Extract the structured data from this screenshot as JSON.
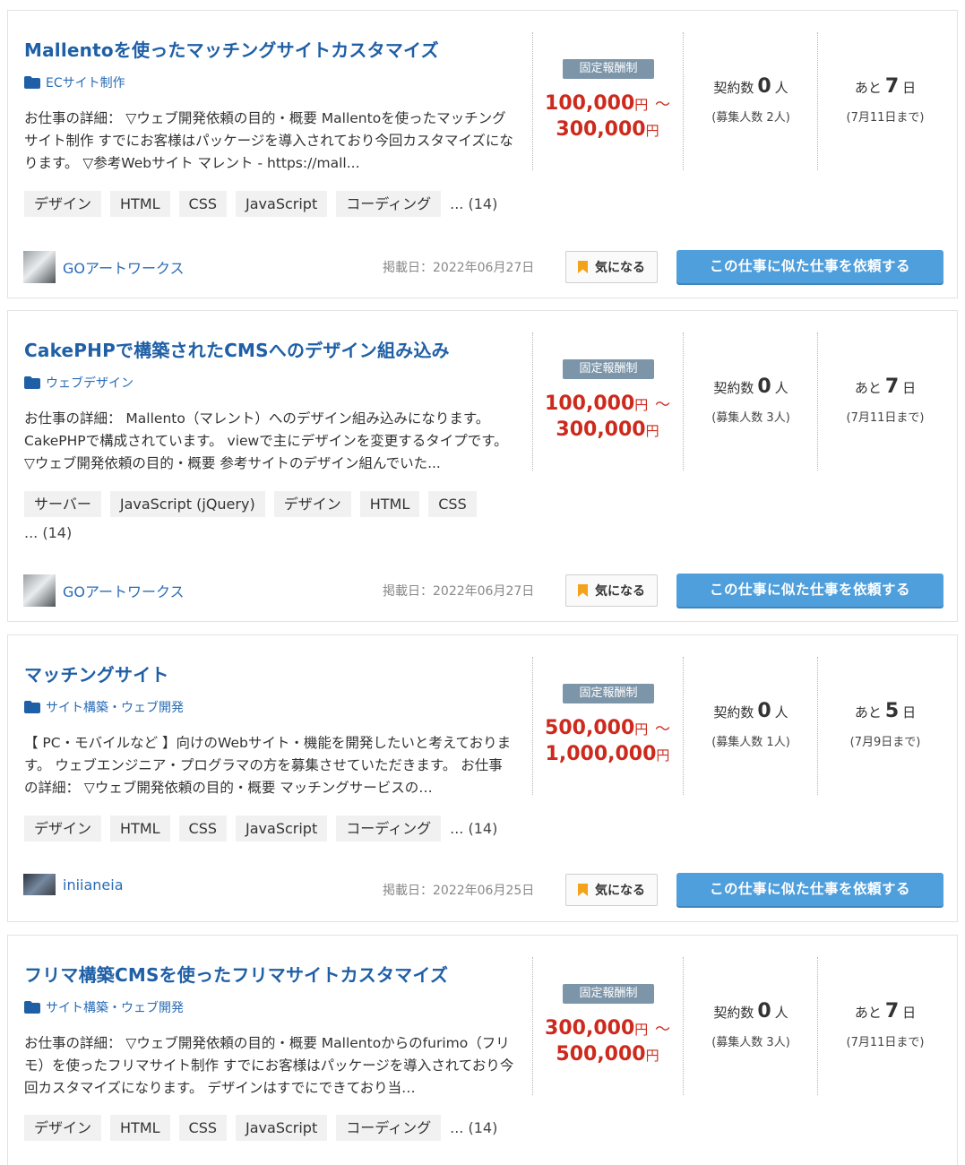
{
  "jobs": [
    {
      "title": "Mallentoを使ったマッチングサイトカスタマイズ",
      "category": "ECサイト制作",
      "description": "お仕事の詳細： ▽ウェブ開発依頼の目的・概要 Mallentoを使ったマッチングサイト制作 すでにお客様はパッケージを導入されており今回カスタマイズになります。 ▽参考Webサイト マレント - https://mall...",
      "tags": [
        "デザイン",
        "HTML",
        "CSS",
        "JavaScript",
        "コーディング"
      ],
      "tag_more": "...  (14)",
      "badge": "固定報酬制",
      "price_min": "100,000",
      "price_max": "300,000",
      "yen": "円",
      "tilde": "〜",
      "contract_prefix": "契約数",
      "contract_count": "0",
      "contract_unit": "人",
      "recruit": "(募集人数 2人)",
      "deadline_prefix": "あと",
      "deadline_days": "7",
      "deadline_unit": "日",
      "deadline_date": "(7月11日まで)",
      "client": "GOアートワークス",
      "posted": "掲載日：2022年06月27日",
      "fav_label": "気になる",
      "request_label": "この仕事に似た仕事を依頼する"
    },
    {
      "title": "CakePHPで構築されたCMSへのデザイン組み込み",
      "category": "ウェブデザイン",
      "description": "お仕事の詳細： Mallento（マレント）へのデザイン組み込みになります。CakePHPで構成されています。 viewで主にデザインを変更するタイプです。 ▽ウェブ開発依頼の目的・概要 参考サイトのデザイン組んでいた...",
      "tags": [
        "サーバー",
        "JavaScript (jQuery)",
        "デザイン",
        "HTML",
        "CSS"
      ],
      "tag_more": "...  (14)",
      "badge": "固定報酬制",
      "price_min": "100,000",
      "price_max": "300,000",
      "yen": "円",
      "tilde": "〜",
      "contract_prefix": "契約数",
      "contract_count": "0",
      "contract_unit": "人",
      "recruit": "(募集人数 3人)",
      "deadline_prefix": "あと",
      "deadline_days": "7",
      "deadline_unit": "日",
      "deadline_date": "(7月11日まで)",
      "client": "GOアートワークス",
      "posted": "掲載日：2022年06月27日",
      "fav_label": "気になる",
      "request_label": "この仕事に似た仕事を依頼する"
    },
    {
      "title": "マッチングサイト",
      "category": "サイト構築・ウェブ開発",
      "description": "【 PC・モバイルなど 】向けのWebサイト・機能を開発したいと考えております。 ウェブエンジニア・プログラマの方を募集させていただきます。 お仕事の詳細： ▽ウェブ開発依頼の目的・概要 マッチングサービスの…",
      "tags": [
        "デザイン",
        "HTML",
        "CSS",
        "JavaScript",
        "コーディング"
      ],
      "tag_more": "...  (14)",
      "badge": "固定報酬制",
      "price_min": "500,000",
      "price_max": "1,000,000",
      "yen": "円",
      "tilde": "〜",
      "contract_prefix": "契約数",
      "contract_count": "0",
      "contract_unit": "人",
      "recruit": "(募集人数 1人)",
      "deadline_prefix": "あと",
      "deadline_days": "5",
      "deadline_unit": "日",
      "deadline_date": "(7月9日まで)",
      "client": "iniianeia",
      "posted": "掲載日：2022年06月25日",
      "fav_label": "気になる",
      "request_label": "この仕事に似た仕事を依頼する"
    },
    {
      "title": "フリマ構築CMSを使ったフリマサイトカスタマイズ",
      "category": "サイト構築・ウェブ開発",
      "description": "お仕事の詳細： ▽ウェブ開発依頼の目的・概要 Mallentoからのfurimo（フリモ）を使ったフリマサイト制作 すでにお客様はパッケージを導入されており今回カスタマイズになります。 デザインはすでにできており当…",
      "tags": [
        "デザイン",
        "HTML",
        "CSS",
        "JavaScript",
        "コーディング"
      ],
      "tag_more": "...  (14)",
      "badge": "固定報酬制",
      "price_min": "300,000",
      "price_max": "500,000",
      "yen": "円",
      "tilde": "〜",
      "contract_prefix": "契約数",
      "contract_count": "0",
      "contract_unit": "人",
      "recruit": "(募集人数 3人)",
      "deadline_prefix": "あと",
      "deadline_days": "7",
      "deadline_unit": "日",
      "deadline_date": "(7月11日まで)",
      "client": "",
      "posted": "",
      "fav_label": "",
      "request_label": ""
    }
  ]
}
